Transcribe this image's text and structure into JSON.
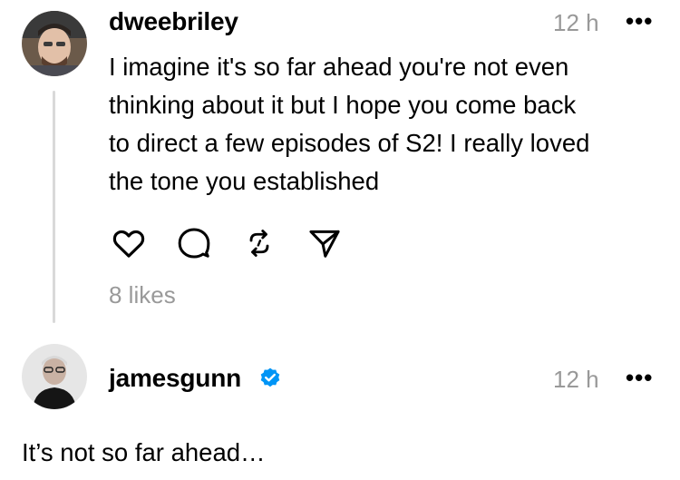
{
  "reply": {
    "username": "dweebriley",
    "time": "12 h",
    "more": "•••",
    "text_lines": [
      "I imagine it's so far ahead you're not even",
      "thinking about it but I hope you come back",
      "to direct a few episodes of S2! I really loved",
      "the tone you established"
    ],
    "likes": "8 likes",
    "actions": [
      "heart-icon",
      "comment-icon",
      "repost-icon",
      "send-icon"
    ]
  },
  "response": {
    "username": "jamesgunn",
    "verified": true,
    "time": "12 h",
    "more": "•••",
    "text": "It’s not so far ahead…"
  },
  "colors": {
    "muted": "#999999",
    "verified": "#0095f6",
    "thread_line": "#d9d9d9"
  }
}
